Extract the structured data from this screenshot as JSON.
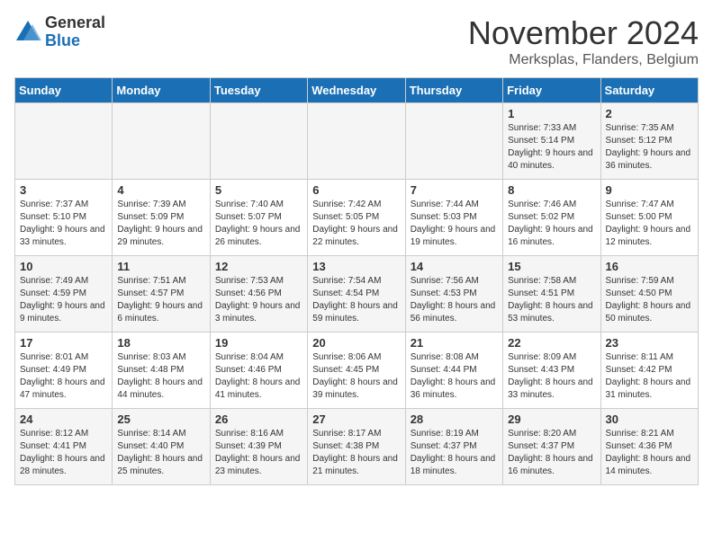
{
  "logo": {
    "general": "General",
    "blue": "Blue"
  },
  "header": {
    "month": "November 2024",
    "location": "Merksplas, Flanders, Belgium"
  },
  "days_of_week": [
    "Sunday",
    "Monday",
    "Tuesday",
    "Wednesday",
    "Thursday",
    "Friday",
    "Saturday"
  ],
  "weeks": [
    [
      {
        "day": "",
        "info": ""
      },
      {
        "day": "",
        "info": ""
      },
      {
        "day": "",
        "info": ""
      },
      {
        "day": "",
        "info": ""
      },
      {
        "day": "",
        "info": ""
      },
      {
        "day": "1",
        "info": "Sunrise: 7:33 AM\nSunset: 5:14 PM\nDaylight: 9 hours and 40 minutes."
      },
      {
        "day": "2",
        "info": "Sunrise: 7:35 AM\nSunset: 5:12 PM\nDaylight: 9 hours and 36 minutes."
      }
    ],
    [
      {
        "day": "3",
        "info": "Sunrise: 7:37 AM\nSunset: 5:10 PM\nDaylight: 9 hours and 33 minutes."
      },
      {
        "day": "4",
        "info": "Sunrise: 7:39 AM\nSunset: 5:09 PM\nDaylight: 9 hours and 29 minutes."
      },
      {
        "day": "5",
        "info": "Sunrise: 7:40 AM\nSunset: 5:07 PM\nDaylight: 9 hours and 26 minutes."
      },
      {
        "day": "6",
        "info": "Sunrise: 7:42 AM\nSunset: 5:05 PM\nDaylight: 9 hours and 22 minutes."
      },
      {
        "day": "7",
        "info": "Sunrise: 7:44 AM\nSunset: 5:03 PM\nDaylight: 9 hours and 19 minutes."
      },
      {
        "day": "8",
        "info": "Sunrise: 7:46 AM\nSunset: 5:02 PM\nDaylight: 9 hours and 16 minutes."
      },
      {
        "day": "9",
        "info": "Sunrise: 7:47 AM\nSunset: 5:00 PM\nDaylight: 9 hours and 12 minutes."
      }
    ],
    [
      {
        "day": "10",
        "info": "Sunrise: 7:49 AM\nSunset: 4:59 PM\nDaylight: 9 hours and 9 minutes."
      },
      {
        "day": "11",
        "info": "Sunrise: 7:51 AM\nSunset: 4:57 PM\nDaylight: 9 hours and 6 minutes."
      },
      {
        "day": "12",
        "info": "Sunrise: 7:53 AM\nSunset: 4:56 PM\nDaylight: 9 hours and 3 minutes."
      },
      {
        "day": "13",
        "info": "Sunrise: 7:54 AM\nSunset: 4:54 PM\nDaylight: 8 hours and 59 minutes."
      },
      {
        "day": "14",
        "info": "Sunrise: 7:56 AM\nSunset: 4:53 PM\nDaylight: 8 hours and 56 minutes."
      },
      {
        "day": "15",
        "info": "Sunrise: 7:58 AM\nSunset: 4:51 PM\nDaylight: 8 hours and 53 minutes."
      },
      {
        "day": "16",
        "info": "Sunrise: 7:59 AM\nSunset: 4:50 PM\nDaylight: 8 hours and 50 minutes."
      }
    ],
    [
      {
        "day": "17",
        "info": "Sunrise: 8:01 AM\nSunset: 4:49 PM\nDaylight: 8 hours and 47 minutes."
      },
      {
        "day": "18",
        "info": "Sunrise: 8:03 AM\nSunset: 4:48 PM\nDaylight: 8 hours and 44 minutes."
      },
      {
        "day": "19",
        "info": "Sunrise: 8:04 AM\nSunset: 4:46 PM\nDaylight: 8 hours and 41 minutes."
      },
      {
        "day": "20",
        "info": "Sunrise: 8:06 AM\nSunset: 4:45 PM\nDaylight: 8 hours and 39 minutes."
      },
      {
        "day": "21",
        "info": "Sunrise: 8:08 AM\nSunset: 4:44 PM\nDaylight: 8 hours and 36 minutes."
      },
      {
        "day": "22",
        "info": "Sunrise: 8:09 AM\nSunset: 4:43 PM\nDaylight: 8 hours and 33 minutes."
      },
      {
        "day": "23",
        "info": "Sunrise: 8:11 AM\nSunset: 4:42 PM\nDaylight: 8 hours and 31 minutes."
      }
    ],
    [
      {
        "day": "24",
        "info": "Sunrise: 8:12 AM\nSunset: 4:41 PM\nDaylight: 8 hours and 28 minutes."
      },
      {
        "day": "25",
        "info": "Sunrise: 8:14 AM\nSunset: 4:40 PM\nDaylight: 8 hours and 25 minutes."
      },
      {
        "day": "26",
        "info": "Sunrise: 8:16 AM\nSunset: 4:39 PM\nDaylight: 8 hours and 23 minutes."
      },
      {
        "day": "27",
        "info": "Sunrise: 8:17 AM\nSunset: 4:38 PM\nDaylight: 8 hours and 21 minutes."
      },
      {
        "day": "28",
        "info": "Sunrise: 8:19 AM\nSunset: 4:37 PM\nDaylight: 8 hours and 18 minutes."
      },
      {
        "day": "29",
        "info": "Sunrise: 8:20 AM\nSunset: 4:37 PM\nDaylight: 8 hours and 16 minutes."
      },
      {
        "day": "30",
        "info": "Sunrise: 8:21 AM\nSunset: 4:36 PM\nDaylight: 8 hours and 14 minutes."
      }
    ]
  ]
}
